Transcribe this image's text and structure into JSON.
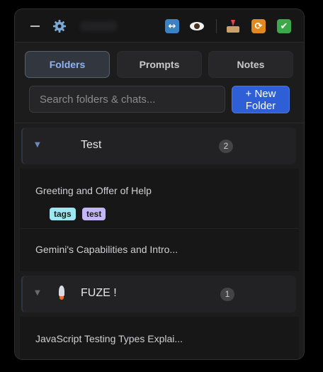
{
  "header": {
    "buttons": [
      {
        "name": "minimize",
        "icon": "minimize-icon"
      },
      {
        "name": "settings",
        "icon": "gear-icon"
      },
      {
        "name": "swap",
        "icon": "left-right-arrow-icon",
        "glyph": "↔"
      },
      {
        "name": "preview",
        "icon": "eye-icon"
      },
      {
        "name": "import",
        "icon": "inbox-tray-icon"
      },
      {
        "name": "sync",
        "icon": "repeat-icon",
        "glyph": "🔁"
      },
      {
        "name": "done",
        "icon": "check-mark-icon",
        "glyph": "✔"
      }
    ],
    "gear_glyph": "⚙"
  },
  "tabs": [
    {
      "label": "Folders",
      "active": true
    },
    {
      "label": "Prompts",
      "active": false
    },
    {
      "label": "Notes",
      "active": false
    }
  ],
  "search": {
    "placeholder": "Search folders & chats...",
    "value": ""
  },
  "new_folder_label": "+ New Folder",
  "folders": [
    {
      "name": "Test",
      "icon": "star-icon",
      "count": "2",
      "expanded": true,
      "chevron": "▼",
      "chats": [
        {
          "title": "Greeting and Offer of Help",
          "tags": [
            "tags",
            "test"
          ]
        },
        {
          "title": "Gemini's Capabilities and Intro...",
          "tags": []
        }
      ]
    },
    {
      "name": "FUZE !",
      "icon": "rocket-icon",
      "count": "1",
      "expanded": true,
      "chevron": "▼",
      "chats": [
        {
          "title": "JavaScript Testing Types Explai...",
          "tags": []
        }
      ]
    }
  ],
  "colors": {
    "accent": "#2f5fd6",
    "active_tab_text": "#8fb3f5",
    "tag_tags": "#9ee6f0",
    "tag_test": "#c4b5f5"
  }
}
